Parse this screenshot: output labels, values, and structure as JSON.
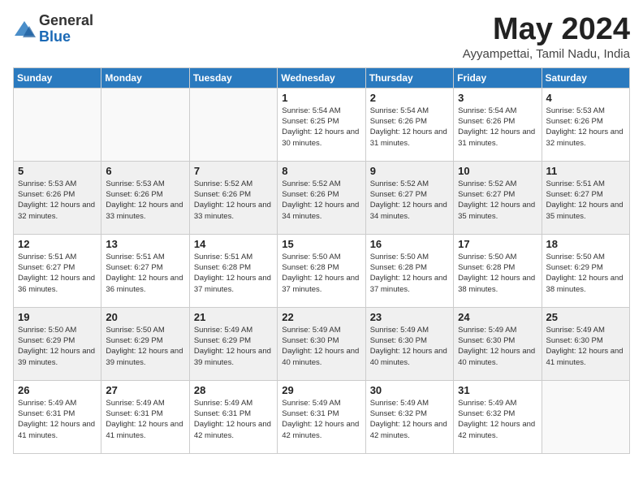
{
  "logo": {
    "general": "General",
    "blue": "Blue"
  },
  "title": {
    "month_year": "May 2024",
    "location": "Ayyampettai, Tamil Nadu, India"
  },
  "headers": [
    "Sunday",
    "Monday",
    "Tuesday",
    "Wednesday",
    "Thursday",
    "Friday",
    "Saturday"
  ],
  "weeks": [
    [
      {
        "day": "",
        "sunrise": "",
        "sunset": "",
        "daylight": ""
      },
      {
        "day": "",
        "sunrise": "",
        "sunset": "",
        "daylight": ""
      },
      {
        "day": "",
        "sunrise": "",
        "sunset": "",
        "daylight": ""
      },
      {
        "day": "1",
        "sunrise": "Sunrise: 5:54 AM",
        "sunset": "Sunset: 6:25 PM",
        "daylight": "Daylight: 12 hours and 30 minutes."
      },
      {
        "day": "2",
        "sunrise": "Sunrise: 5:54 AM",
        "sunset": "Sunset: 6:26 PM",
        "daylight": "Daylight: 12 hours and 31 minutes."
      },
      {
        "day": "3",
        "sunrise": "Sunrise: 5:54 AM",
        "sunset": "Sunset: 6:26 PM",
        "daylight": "Daylight: 12 hours and 31 minutes."
      },
      {
        "day": "4",
        "sunrise": "Sunrise: 5:53 AM",
        "sunset": "Sunset: 6:26 PM",
        "daylight": "Daylight: 12 hours and 32 minutes."
      }
    ],
    [
      {
        "day": "5",
        "sunrise": "Sunrise: 5:53 AM",
        "sunset": "Sunset: 6:26 PM",
        "daylight": "Daylight: 12 hours and 32 minutes."
      },
      {
        "day": "6",
        "sunrise": "Sunrise: 5:53 AM",
        "sunset": "Sunset: 6:26 PM",
        "daylight": "Daylight: 12 hours and 33 minutes."
      },
      {
        "day": "7",
        "sunrise": "Sunrise: 5:52 AM",
        "sunset": "Sunset: 6:26 PM",
        "daylight": "Daylight: 12 hours and 33 minutes."
      },
      {
        "day": "8",
        "sunrise": "Sunrise: 5:52 AM",
        "sunset": "Sunset: 6:26 PM",
        "daylight": "Daylight: 12 hours and 34 minutes."
      },
      {
        "day": "9",
        "sunrise": "Sunrise: 5:52 AM",
        "sunset": "Sunset: 6:27 PM",
        "daylight": "Daylight: 12 hours and 34 minutes."
      },
      {
        "day": "10",
        "sunrise": "Sunrise: 5:52 AM",
        "sunset": "Sunset: 6:27 PM",
        "daylight": "Daylight: 12 hours and 35 minutes."
      },
      {
        "day": "11",
        "sunrise": "Sunrise: 5:51 AM",
        "sunset": "Sunset: 6:27 PM",
        "daylight": "Daylight: 12 hours and 35 minutes."
      }
    ],
    [
      {
        "day": "12",
        "sunrise": "Sunrise: 5:51 AM",
        "sunset": "Sunset: 6:27 PM",
        "daylight": "Daylight: 12 hours and 36 minutes."
      },
      {
        "day": "13",
        "sunrise": "Sunrise: 5:51 AM",
        "sunset": "Sunset: 6:27 PM",
        "daylight": "Daylight: 12 hours and 36 minutes."
      },
      {
        "day": "14",
        "sunrise": "Sunrise: 5:51 AM",
        "sunset": "Sunset: 6:28 PM",
        "daylight": "Daylight: 12 hours and 37 minutes."
      },
      {
        "day": "15",
        "sunrise": "Sunrise: 5:50 AM",
        "sunset": "Sunset: 6:28 PM",
        "daylight": "Daylight: 12 hours and 37 minutes."
      },
      {
        "day": "16",
        "sunrise": "Sunrise: 5:50 AM",
        "sunset": "Sunset: 6:28 PM",
        "daylight": "Daylight: 12 hours and 37 minutes."
      },
      {
        "day": "17",
        "sunrise": "Sunrise: 5:50 AM",
        "sunset": "Sunset: 6:28 PM",
        "daylight": "Daylight: 12 hours and 38 minutes."
      },
      {
        "day": "18",
        "sunrise": "Sunrise: 5:50 AM",
        "sunset": "Sunset: 6:29 PM",
        "daylight": "Daylight: 12 hours and 38 minutes."
      }
    ],
    [
      {
        "day": "19",
        "sunrise": "Sunrise: 5:50 AM",
        "sunset": "Sunset: 6:29 PM",
        "daylight": "Daylight: 12 hours and 39 minutes."
      },
      {
        "day": "20",
        "sunrise": "Sunrise: 5:50 AM",
        "sunset": "Sunset: 6:29 PM",
        "daylight": "Daylight: 12 hours and 39 minutes."
      },
      {
        "day": "21",
        "sunrise": "Sunrise: 5:49 AM",
        "sunset": "Sunset: 6:29 PM",
        "daylight": "Daylight: 12 hours and 39 minutes."
      },
      {
        "day": "22",
        "sunrise": "Sunrise: 5:49 AM",
        "sunset": "Sunset: 6:30 PM",
        "daylight": "Daylight: 12 hours and 40 minutes."
      },
      {
        "day": "23",
        "sunrise": "Sunrise: 5:49 AM",
        "sunset": "Sunset: 6:30 PM",
        "daylight": "Daylight: 12 hours and 40 minutes."
      },
      {
        "day": "24",
        "sunrise": "Sunrise: 5:49 AM",
        "sunset": "Sunset: 6:30 PM",
        "daylight": "Daylight: 12 hours and 40 minutes."
      },
      {
        "day": "25",
        "sunrise": "Sunrise: 5:49 AM",
        "sunset": "Sunset: 6:30 PM",
        "daylight": "Daylight: 12 hours and 41 minutes."
      }
    ],
    [
      {
        "day": "26",
        "sunrise": "Sunrise: 5:49 AM",
        "sunset": "Sunset: 6:31 PM",
        "daylight": "Daylight: 12 hours and 41 minutes."
      },
      {
        "day": "27",
        "sunrise": "Sunrise: 5:49 AM",
        "sunset": "Sunset: 6:31 PM",
        "daylight": "Daylight: 12 hours and 41 minutes."
      },
      {
        "day": "28",
        "sunrise": "Sunrise: 5:49 AM",
        "sunset": "Sunset: 6:31 PM",
        "daylight": "Daylight: 12 hours and 42 minutes."
      },
      {
        "day": "29",
        "sunrise": "Sunrise: 5:49 AM",
        "sunset": "Sunset: 6:31 PM",
        "daylight": "Daylight: 12 hours and 42 minutes."
      },
      {
        "day": "30",
        "sunrise": "Sunrise: 5:49 AM",
        "sunset": "Sunset: 6:32 PM",
        "daylight": "Daylight: 12 hours and 42 minutes."
      },
      {
        "day": "31",
        "sunrise": "Sunrise: 5:49 AM",
        "sunset": "Sunset: 6:32 PM",
        "daylight": "Daylight: 12 hours and 42 minutes."
      },
      {
        "day": "",
        "sunrise": "",
        "sunset": "",
        "daylight": ""
      }
    ]
  ]
}
